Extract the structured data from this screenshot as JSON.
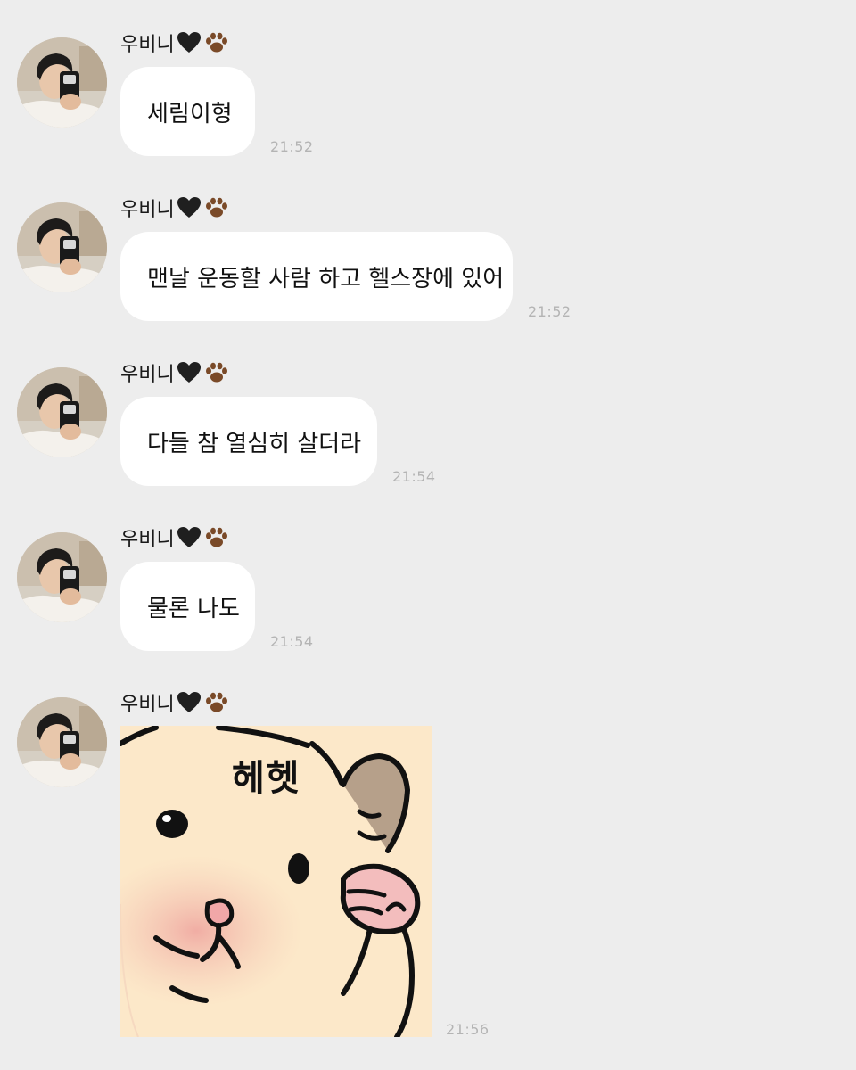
{
  "sender_name": "우비니",
  "messages": [
    {
      "type": "text",
      "text": "세림이형",
      "time": "21:52"
    },
    {
      "type": "text",
      "text": "맨날 운동할 사람 하고 헬스장에 있어",
      "time": "21:52"
    },
    {
      "type": "text",
      "text": "다들 참 열심히 살더라",
      "time": "21:54"
    },
    {
      "type": "text",
      "text": "물론 나도",
      "time": "21:54"
    },
    {
      "type": "sticker",
      "sticker_text": "헤헷",
      "time": "21:56"
    }
  ],
  "icons": {
    "name_suffix": [
      "black-heart-icon",
      "paw-print-icon"
    ],
    "sticker": "hamster-sticker"
  },
  "colors": {
    "background": "#ededed",
    "bubble": "#ffffff",
    "text": "#111111",
    "timestamp": "#b4b4b4",
    "sticker_fill": "#fbe6c5",
    "sticker_blush": "#f1b7b0"
  }
}
